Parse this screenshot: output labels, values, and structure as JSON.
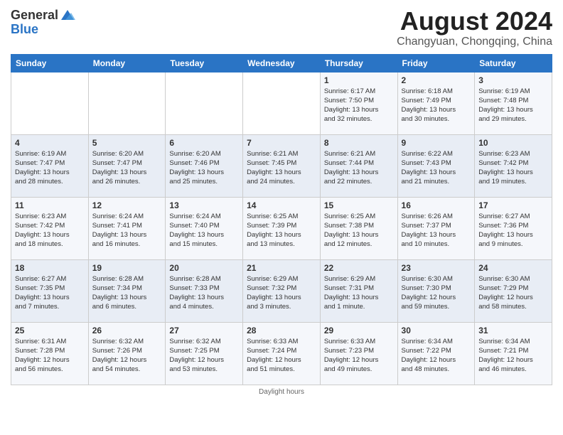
{
  "header": {
    "logo_general": "General",
    "logo_blue": "Blue",
    "title": "August 2024",
    "subtitle": "Changyuan, Chongqing, China"
  },
  "weekdays": [
    "Sunday",
    "Monday",
    "Tuesday",
    "Wednesday",
    "Thursday",
    "Friday",
    "Saturday"
  ],
  "weeks": [
    [
      {
        "day": "",
        "info": ""
      },
      {
        "day": "",
        "info": ""
      },
      {
        "day": "",
        "info": ""
      },
      {
        "day": "",
        "info": ""
      },
      {
        "day": "1",
        "info": "Sunrise: 6:17 AM\nSunset: 7:50 PM\nDaylight: 13 hours\nand 32 minutes."
      },
      {
        "day": "2",
        "info": "Sunrise: 6:18 AM\nSunset: 7:49 PM\nDaylight: 13 hours\nand 30 minutes."
      },
      {
        "day": "3",
        "info": "Sunrise: 6:19 AM\nSunset: 7:48 PM\nDaylight: 13 hours\nand 29 minutes."
      }
    ],
    [
      {
        "day": "4",
        "info": "Sunrise: 6:19 AM\nSunset: 7:47 PM\nDaylight: 13 hours\nand 28 minutes."
      },
      {
        "day": "5",
        "info": "Sunrise: 6:20 AM\nSunset: 7:47 PM\nDaylight: 13 hours\nand 26 minutes."
      },
      {
        "day": "6",
        "info": "Sunrise: 6:20 AM\nSunset: 7:46 PM\nDaylight: 13 hours\nand 25 minutes."
      },
      {
        "day": "7",
        "info": "Sunrise: 6:21 AM\nSunset: 7:45 PM\nDaylight: 13 hours\nand 24 minutes."
      },
      {
        "day": "8",
        "info": "Sunrise: 6:21 AM\nSunset: 7:44 PM\nDaylight: 13 hours\nand 22 minutes."
      },
      {
        "day": "9",
        "info": "Sunrise: 6:22 AM\nSunset: 7:43 PM\nDaylight: 13 hours\nand 21 minutes."
      },
      {
        "day": "10",
        "info": "Sunrise: 6:23 AM\nSunset: 7:42 PM\nDaylight: 13 hours\nand 19 minutes."
      }
    ],
    [
      {
        "day": "11",
        "info": "Sunrise: 6:23 AM\nSunset: 7:42 PM\nDaylight: 13 hours\nand 18 minutes."
      },
      {
        "day": "12",
        "info": "Sunrise: 6:24 AM\nSunset: 7:41 PM\nDaylight: 13 hours\nand 16 minutes."
      },
      {
        "day": "13",
        "info": "Sunrise: 6:24 AM\nSunset: 7:40 PM\nDaylight: 13 hours\nand 15 minutes."
      },
      {
        "day": "14",
        "info": "Sunrise: 6:25 AM\nSunset: 7:39 PM\nDaylight: 13 hours\nand 13 minutes."
      },
      {
        "day": "15",
        "info": "Sunrise: 6:25 AM\nSunset: 7:38 PM\nDaylight: 13 hours\nand 12 minutes."
      },
      {
        "day": "16",
        "info": "Sunrise: 6:26 AM\nSunset: 7:37 PM\nDaylight: 13 hours\nand 10 minutes."
      },
      {
        "day": "17",
        "info": "Sunrise: 6:27 AM\nSunset: 7:36 PM\nDaylight: 13 hours\nand 9 minutes."
      }
    ],
    [
      {
        "day": "18",
        "info": "Sunrise: 6:27 AM\nSunset: 7:35 PM\nDaylight: 13 hours\nand 7 minutes."
      },
      {
        "day": "19",
        "info": "Sunrise: 6:28 AM\nSunset: 7:34 PM\nDaylight: 13 hours\nand 6 minutes."
      },
      {
        "day": "20",
        "info": "Sunrise: 6:28 AM\nSunset: 7:33 PM\nDaylight: 13 hours\nand 4 minutes."
      },
      {
        "day": "21",
        "info": "Sunrise: 6:29 AM\nSunset: 7:32 PM\nDaylight: 13 hours\nand 3 minutes."
      },
      {
        "day": "22",
        "info": "Sunrise: 6:29 AM\nSunset: 7:31 PM\nDaylight: 13 hours\nand 1 minute."
      },
      {
        "day": "23",
        "info": "Sunrise: 6:30 AM\nSunset: 7:30 PM\nDaylight: 12 hours\nand 59 minutes."
      },
      {
        "day": "24",
        "info": "Sunrise: 6:30 AM\nSunset: 7:29 PM\nDaylight: 12 hours\nand 58 minutes."
      }
    ],
    [
      {
        "day": "25",
        "info": "Sunrise: 6:31 AM\nSunset: 7:28 PM\nDaylight: 12 hours\nand 56 minutes."
      },
      {
        "day": "26",
        "info": "Sunrise: 6:32 AM\nSunset: 7:26 PM\nDaylight: 12 hours\nand 54 minutes."
      },
      {
        "day": "27",
        "info": "Sunrise: 6:32 AM\nSunset: 7:25 PM\nDaylight: 12 hours\nand 53 minutes."
      },
      {
        "day": "28",
        "info": "Sunrise: 6:33 AM\nSunset: 7:24 PM\nDaylight: 12 hours\nand 51 minutes."
      },
      {
        "day": "29",
        "info": "Sunrise: 6:33 AM\nSunset: 7:23 PM\nDaylight: 12 hours\nand 49 minutes."
      },
      {
        "day": "30",
        "info": "Sunrise: 6:34 AM\nSunset: 7:22 PM\nDaylight: 12 hours\nand 48 minutes."
      },
      {
        "day": "31",
        "info": "Sunrise: 6:34 AM\nSunset: 7:21 PM\nDaylight: 12 hours\nand 46 minutes."
      }
    ]
  ],
  "footer": {
    "daylight_label": "Daylight hours"
  }
}
